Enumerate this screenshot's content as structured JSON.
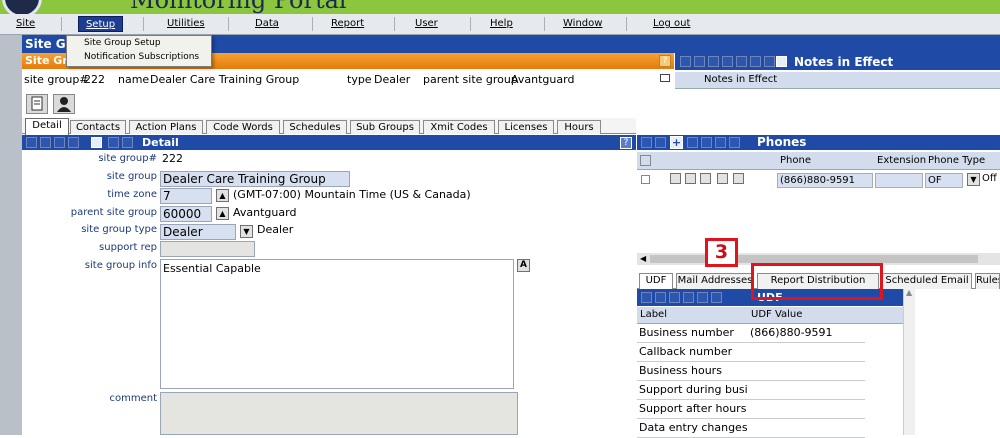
{
  "app": {
    "title": "Monitoring Portal"
  },
  "menu": [
    {
      "label": "Site"
    },
    {
      "label": "Setup"
    },
    {
      "label": "Utilities"
    },
    {
      "label": "Data"
    },
    {
      "label": "Report"
    },
    {
      "label": "User"
    },
    {
      "label": "Help"
    },
    {
      "label": "Window"
    },
    {
      "label": "Log out"
    }
  ],
  "setup_menu": {
    "items": [
      "Site Group Setup",
      "Notification Subscriptions"
    ]
  },
  "window": {
    "title": "Site Gr",
    "subtitle": "Site Group Setup"
  },
  "info": {
    "group_no_label": "site group#",
    "group_no": "222",
    "name_label": "name",
    "name": "Dealer Care Training Group",
    "type_label": "type",
    "type": "Dealer",
    "parent_label": "parent site group",
    "parent": "Avantguard"
  },
  "notes": {
    "title": "Notes in Effect",
    "column": "Notes in Effect"
  },
  "tabs": [
    "Detail",
    "Contacts",
    "Action Plans",
    "Code Words",
    "Schedules",
    "Sub Groups",
    "Xmit Codes",
    "Licenses",
    "Hours"
  ],
  "detail": {
    "panel_title": "Detail",
    "labels": {
      "group_no": "site group#",
      "site_group": "site group",
      "time_zone": "time zone",
      "parent": "parent site group",
      "type": "site group type",
      "support_rep": "support rep",
      "info": "site group info",
      "comment": "comment"
    },
    "group_no": "222",
    "site_group": "Dealer Care Training Group",
    "time_zone_code": "7",
    "time_zone_name": "(GMT-07:00) Mountain Time (US & Canada)",
    "parent_code": "60000",
    "parent_name": "Avantguard",
    "type_value": "Dealer",
    "type_name": "Dealer",
    "support_rep": "",
    "info": "Essential Capable",
    "comment": ""
  },
  "phones": {
    "title": "Phones",
    "columns": [
      "Phone",
      "Extension",
      "Phone Type"
    ],
    "rows": [
      {
        "phone": "(866)880-9591",
        "extension": "",
        "type": "OF",
        "type_name": "Off"
      }
    ]
  },
  "bottom_tabs": [
    "UDF",
    "Mail Addresses",
    "Report Distribution",
    "Scheduled Email",
    "Rules"
  ],
  "udf": {
    "title": "UDF",
    "columns": [
      "Label",
      "UDF Value"
    ],
    "rows": [
      {
        "label": "Business number",
        "value": "(866)880-9591"
      },
      {
        "label": "Callback number",
        "value": ""
      },
      {
        "label": "Business hours",
        "value": ""
      },
      {
        "label": "Support during business hours",
        "value": ""
      },
      {
        "label": "Support after hours",
        "value": ""
      },
      {
        "label": "Data entry changes",
        "value": ""
      }
    ]
  },
  "annotation": {
    "step": "3"
  },
  "colors": {
    "header_blue": "#1f4aa5",
    "setup_orange": "#f08a1c",
    "highlight_red": "#e0141c",
    "brand_green": "#8cc63f"
  }
}
